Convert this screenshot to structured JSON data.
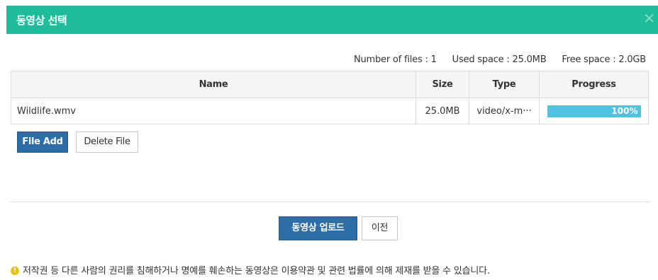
{
  "dialog": {
    "title": "동영상 선택",
    "close_icon": "close-icon"
  },
  "stats": {
    "files_label": "Number of files :",
    "files_value": "1",
    "used_label": "Used space :",
    "used_value": "25.0MB",
    "free_label": "Free space :",
    "free_value": "2.0GB"
  },
  "table": {
    "headers": {
      "name": "Name",
      "size": "Size",
      "type": "Type",
      "progress": "Progress"
    },
    "rows": [
      {
        "name": "Wildlife.wmv",
        "size": "25.0MB",
        "type": "video/x-m···",
        "progress": 1.0,
        "progress_text": "100%"
      }
    ]
  },
  "buttons": {
    "file_add": "File Add",
    "delete_file": "Delete File",
    "upload": "동영상 업로드",
    "previous": "이전"
  },
  "notice": {
    "icon": "warning-icon",
    "text": "저작권 등 다른 사람의 권리를 침해하거나 명예를 훼손하는 동영상은 이용약관 및 관련 법률에 의해 제재를 받을 수 있습니다."
  },
  "colors": {
    "header_green": "#1fbc9c",
    "primary_blue": "#2d6da8",
    "progress_blue": "#4fc3e1",
    "warning_yellow": "#e7c11a"
  }
}
